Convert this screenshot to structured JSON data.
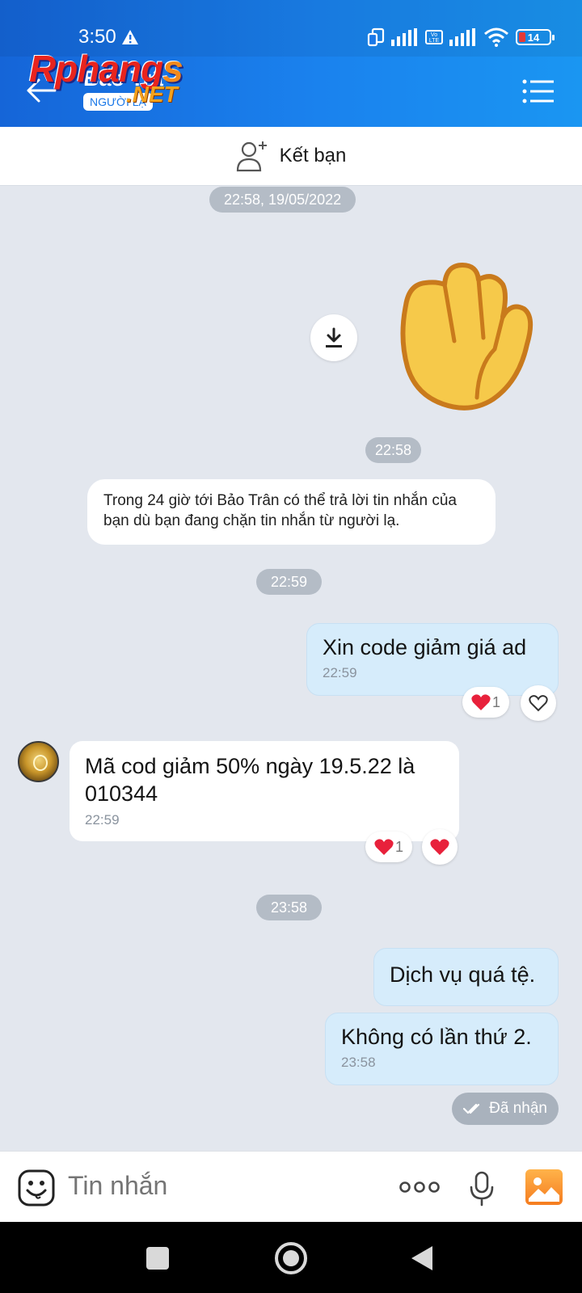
{
  "status_bar": {
    "time": "3:50",
    "battery": "14",
    "volte": "Vo LTE"
  },
  "header": {
    "title": "Bảo Trâ",
    "subtitle": "NGƯỜI LẠ",
    "watermark_main": "Rphang",
    "watermark_s": "s",
    "watermark_net": ".NET"
  },
  "friend_bar": {
    "label": "Kết bạn"
  },
  "messages": {
    "date_divider": "22:58, 19/05/2022",
    "sticker_time": "22:58",
    "system_notice": "Trong 24 giờ tới Bảo Trân có thể trả lời tin nhắn của bạn dù bạn đang chặn tin nhắn từ người lạ.",
    "divider_2": "22:59",
    "out_1": {
      "text": "Xin code giảm giá ad",
      "time": "22:59",
      "reaction_count": "1"
    },
    "in_1": {
      "text": "Mã cod giảm 50% ngày 19.5.22 là 010344",
      "time": "22:59",
      "reaction_count": "1"
    },
    "divider_3": "23:58",
    "out_2": {
      "text": "Dịch vụ quá tệ."
    },
    "out_3": {
      "text": "Không có lần thứ 2.",
      "time": "23:58"
    },
    "seen_status": "Đã nhận"
  },
  "composer": {
    "placeholder": "Tin nhắn"
  },
  "colors": {
    "header_start": "#1565d8",
    "header_end": "#1a96f2",
    "outgoing_bubble": "#d6ecfb",
    "chat_bg": "#e3e7ee",
    "heart": "#e8213b"
  },
  "icons": [
    "warning-icon",
    "sim-icon",
    "signal-icon",
    "wifi-icon",
    "battery-icon",
    "back-arrow-icon",
    "menu-list-icon",
    "add-friend-icon",
    "download-icon",
    "raised-hand-sticker",
    "heart-icon",
    "heart-outline-icon",
    "double-check-icon",
    "emoji-icon",
    "more-dots-icon",
    "mic-icon",
    "image-icon"
  ]
}
